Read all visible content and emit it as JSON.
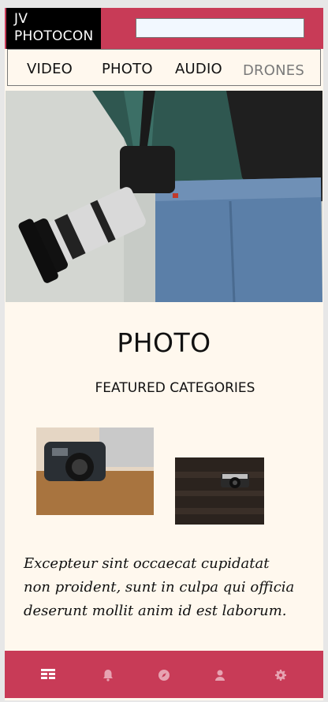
{
  "header": {
    "logo_line1": "JV",
    "logo_line2": "PHOTOCON",
    "search_value": ""
  },
  "nav": {
    "items": [
      {
        "label": "VIDEO"
      },
      {
        "label": "PHOTO"
      },
      {
        "label": "AUDIO"
      },
      {
        "label": "DRONES"
      }
    ]
  },
  "main": {
    "title": "PHOTO",
    "subtitle": "FEATURED CATEGORIES",
    "body_text": "Excepteur sint occaecat cupidatat non proident, sunt in culpa qui officia deserunt mollit anim id est laborum."
  },
  "tabbar": {
    "active": "home",
    "icons": [
      "list-icon",
      "bell-icon",
      "compass-icon",
      "user-icon",
      "gear-icon"
    ]
  },
  "colors": {
    "accent": "#c83b57",
    "page_bg": "#fff8ee",
    "active_tab_icon": "#ffffff",
    "inactive_tab_icon": "#e7a3b2"
  }
}
